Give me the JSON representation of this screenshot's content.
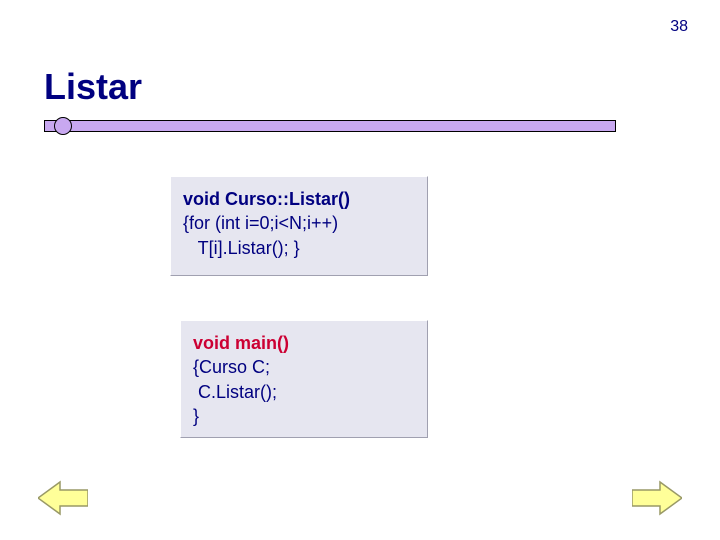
{
  "page_number": "38",
  "title": "Listar",
  "colors": {
    "heading": "#000080",
    "accent_bar": "#c8a8f0",
    "code_bg": "#e6e6f0",
    "highlight": "#cc0033",
    "arrow_fill": "#ffff99",
    "arrow_stroke": "#999966"
  },
  "code_block_1": {
    "line1_bold": "void Curso::Listar()",
    "line2": "{for (int i=0;i<N;i++)",
    "line3": "   T[i].Listar(); }"
  },
  "code_block_2": {
    "line1_bold_red": "void main()",
    "line2": "{Curso C;",
    "line3": " C.Listar();",
    "line4": "}"
  },
  "nav": {
    "prev": "previous-slide",
    "next": "next-slide"
  }
}
